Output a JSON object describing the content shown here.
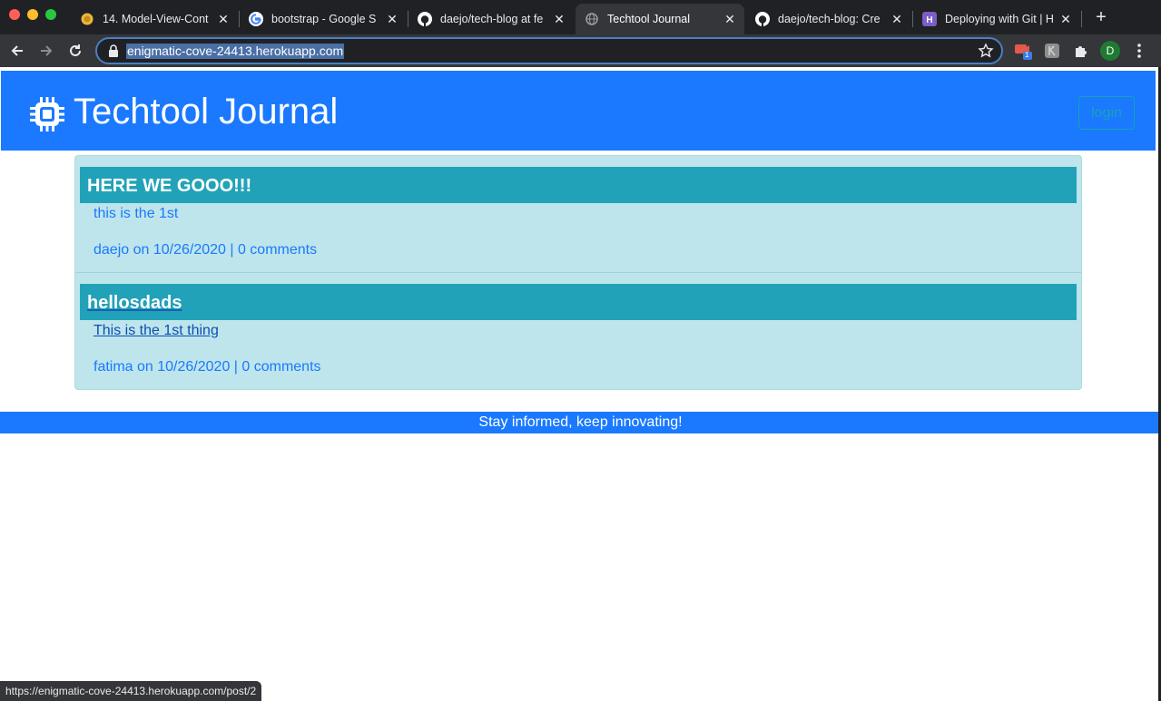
{
  "browser": {
    "tabs": [
      {
        "title": "14. Model-View-Cont",
        "icon": "lemon-icon"
      },
      {
        "title": "bootstrap - Google S",
        "icon": "google-icon"
      },
      {
        "title": "daejo/tech-blog at fe",
        "icon": "github-icon"
      },
      {
        "title": "Techtool Journal",
        "icon": "globe-icon",
        "active": true
      },
      {
        "title": "daejo/tech-blog: Cre",
        "icon": "github-icon"
      },
      {
        "title": "Deploying with Git | H",
        "icon": "heroku-icon"
      }
    ],
    "new_tab_label": "+",
    "url": "enigmatic-cove-24413.herokuapp.com",
    "profile_initial": "D",
    "extension_badge": "1",
    "status_url": "https://enigmatic-cove-24413.herokuapp.com/post/2"
  },
  "site": {
    "brand": "Techtool Journal",
    "login_label": "login",
    "footer_text": "Stay informed, keep innovating!"
  },
  "posts": [
    {
      "title": "HERE WE GOOO!!!",
      "body": "this is the 1st",
      "meta": "daejo on 10/26/2020 | 0 comments"
    },
    {
      "title": "hellosdads",
      "body": "This is the 1st thing",
      "meta": "fatima on 10/26/2020 | 0 comments"
    }
  ],
  "colors": {
    "header": "#1a79ff",
    "post_title_bar": "#22a2b8",
    "post_bg": "#bee5eb",
    "login_outline": "#17a2b8"
  }
}
